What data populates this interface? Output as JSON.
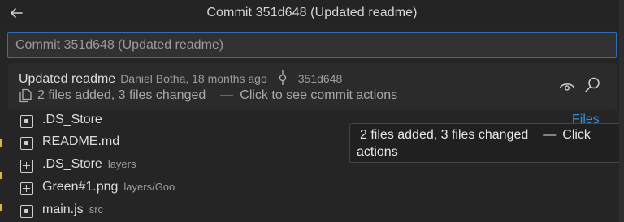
{
  "header": {
    "title": "Commit 351d648 (Updated readme)",
    "back_icon": "arrow-left-icon"
  },
  "search": {
    "value": "Commit 351d648 (Updated readme)",
    "placeholder": ""
  },
  "commit": {
    "message": "Updated readme",
    "author_date": "Daniel Botha, 18 months ago",
    "commit_icon": "git-commit-icon",
    "hash": "351d648",
    "files_icon": "files-icon",
    "summary": "2 files added, 3 files changed",
    "dash": "—",
    "hint": "Click to see commit actions",
    "actions": [
      {
        "icon": "eye-icon"
      },
      {
        "icon": "search-icon"
      }
    ]
  },
  "files_label": "Files",
  "files": [
    {
      "name": ".DS_Store",
      "path": "",
      "status": "modified",
      "icon": "modified-file-icon"
    },
    {
      "name": "README.md",
      "path": "",
      "status": "modified",
      "icon": "modified-file-icon"
    },
    {
      "name": ".DS_Store",
      "path": "layers",
      "status": "added",
      "icon": "added-file-icon"
    },
    {
      "name": "Green#1.png",
      "path": "layers/Goo",
      "status": "added",
      "icon": "added-file-icon"
    },
    {
      "name": "main.js",
      "path": "src",
      "status": "modified",
      "icon": "modified-file-icon"
    }
  ],
  "tooltip": {
    "summary": "2 files added, 3 files changed",
    "dash": "—",
    "click": "Click",
    "actions": "actions"
  },
  "colors": {
    "background": "#252526",
    "focus_border": "#2f6fb4",
    "link_blue": "#3d8fd8",
    "modified_marker": "#d7ba4a"
  }
}
